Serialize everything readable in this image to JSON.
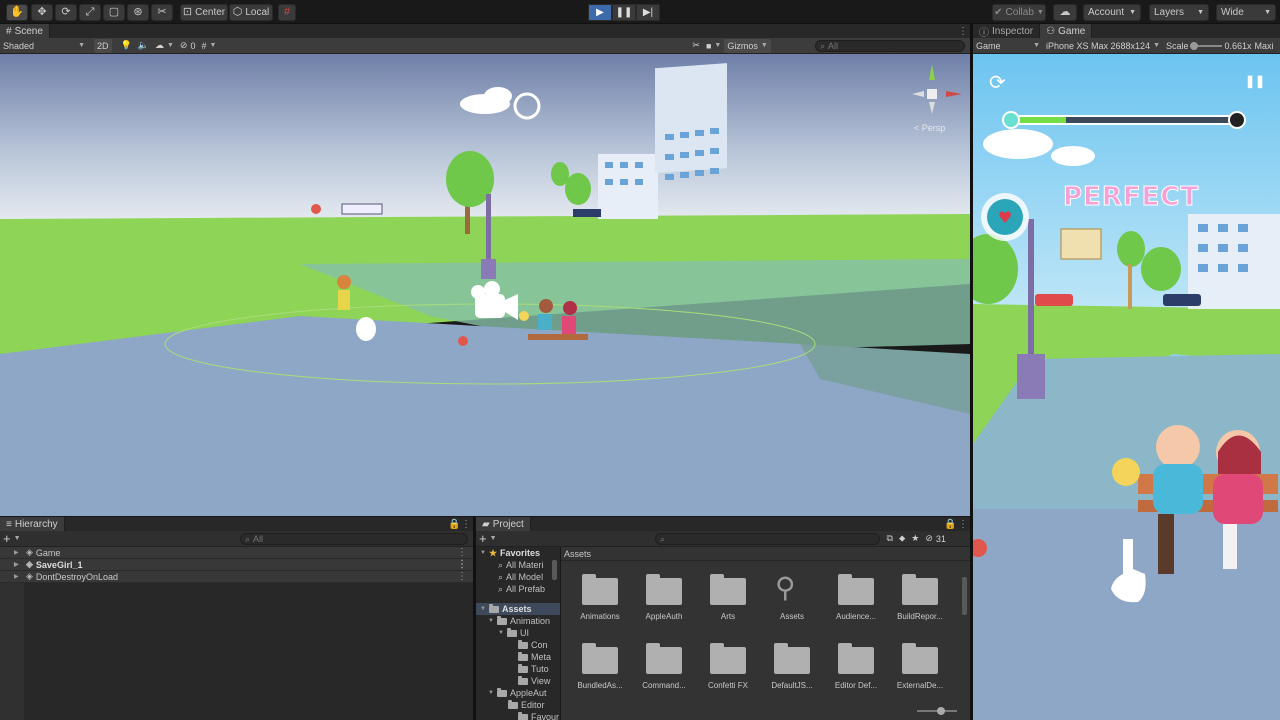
{
  "toolbar": {
    "tools": [
      "hand-tool",
      "move-tool",
      "rotate-tool",
      "scale-tool",
      "rect-tool",
      "transform-tool",
      "custom-tool"
    ],
    "center_label": "Center",
    "local_label": "Local",
    "collab_label": "Collab",
    "account_label": "Account",
    "layers_label": "Layers",
    "layout_label": "Wide"
  },
  "scene": {
    "tab_label": "Scene",
    "shading_mode": "Shaded",
    "mode_2d": "2D",
    "hidden_count": "0",
    "gizmos_label": "Gizmos",
    "search_placeholder": "All",
    "persp_label": "< Persp"
  },
  "inspector": {
    "tab_label": "Inspector"
  },
  "game": {
    "tab_label": "Game",
    "display_label": "Game",
    "resolution": "iPhone XS Max 2688x124",
    "scale_label": "Scale",
    "scale_value": "0.661x",
    "maximize_label": "Maxi",
    "perfect_text": "PERFECT",
    "progress": 0.25
  },
  "hierarchy": {
    "tab_label": "Hierarchy",
    "search_placeholder": "All",
    "items": [
      {
        "label": "Game",
        "bold": false
      },
      {
        "label": "SaveGirl_1",
        "bold": true
      },
      {
        "label": "DontDestroyOnLoad",
        "bold": false
      }
    ]
  },
  "project": {
    "tab_label": "Project",
    "count": "31",
    "favorites_label": "Favorites",
    "favorites": [
      "All Materi",
      "All Model",
      "All Prefab"
    ],
    "assets_label": "Assets",
    "tree": [
      "Animation",
      "UI",
      "Con",
      "Meta",
      "Tuto",
      "View",
      "AppleAut",
      "Editor",
      "Favour"
    ],
    "breadcrumb": "Assets",
    "grid": [
      "Animations",
      "AppleAuth",
      "Arts",
      "Assets",
      "Audience...",
      "BuildRepor...",
      "BundledAs...",
      "Command...",
      "Confetti FX",
      "DefaultJS...",
      "Editor Def...",
      "ExternalDe..."
    ]
  }
}
